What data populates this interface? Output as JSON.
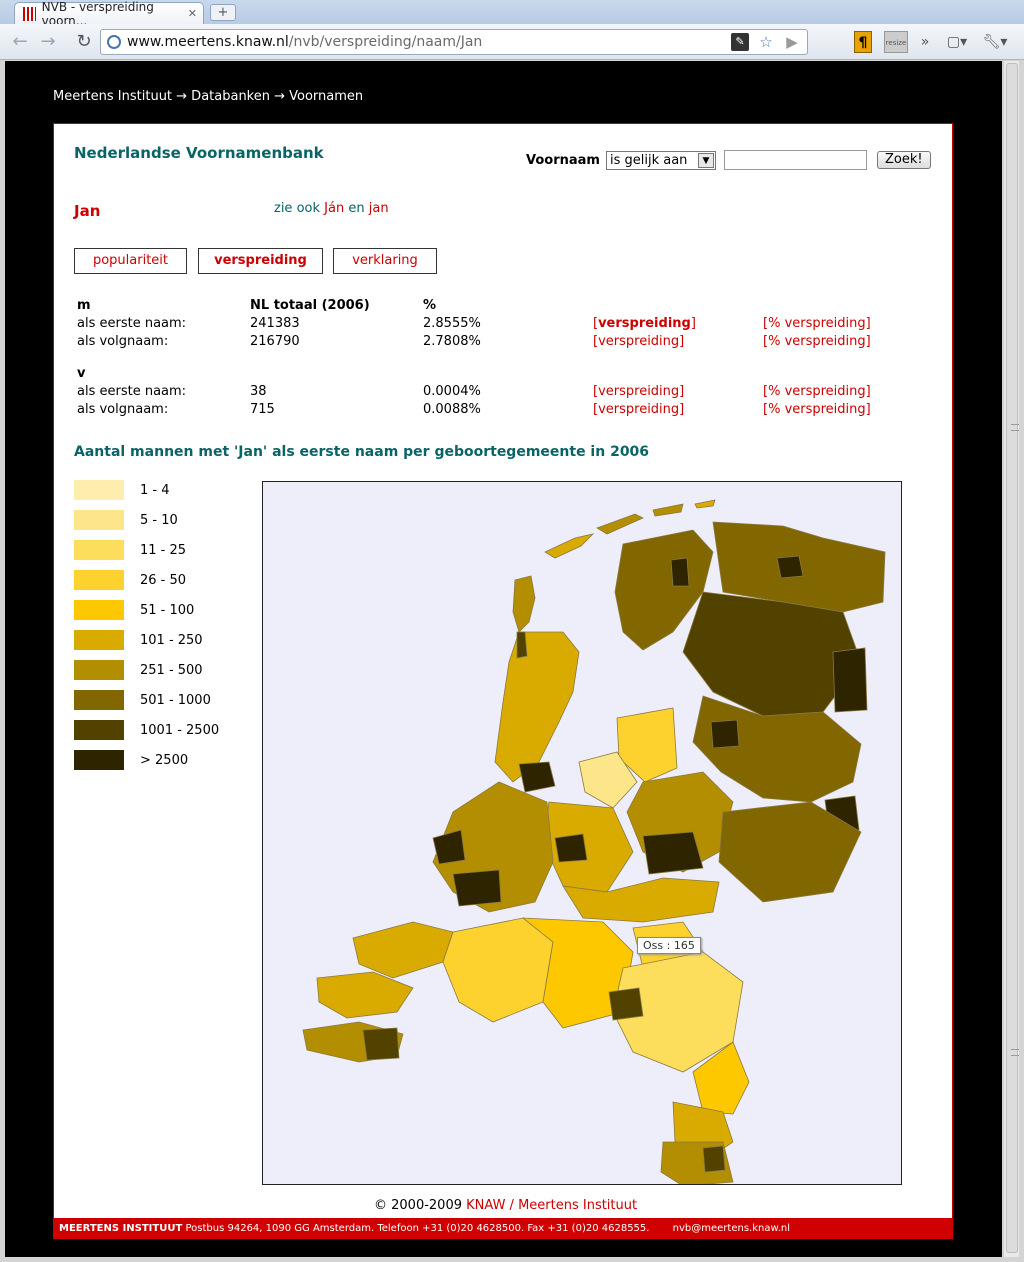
{
  "browser": {
    "tab_title": "NVB - verspreiding voorn...",
    "url_host": "www.meertens.knaw.nl",
    "url_path": "/nvb/verspreiding/naam/Jan",
    "resize_label": "resize"
  },
  "breadcrumb": {
    "text": "Meertens Instituut → Databanken → Voornamen"
  },
  "header": {
    "site_title": "Nederlandse Voornamenbank",
    "search_label": "Voornaam",
    "search_operator": "is gelijk aan",
    "search_value": "",
    "search_button": "Zoek!"
  },
  "name": {
    "title": "Jan",
    "see_also_prefix": "zie ook",
    "see_also_1": "Ján",
    "see_also_join": "en",
    "see_also_2": "jan"
  },
  "tabs": [
    {
      "label": "populariteit",
      "active": false
    },
    {
      "label": "verspreiding",
      "active": true
    },
    {
      "label": "verklaring",
      "active": false
    }
  ],
  "stats": {
    "col_total": "NL totaal (2006)",
    "col_pct": "%",
    "m_label": "m",
    "v_label": "v",
    "m_rows": [
      {
        "label": "als eerste naam:",
        "total": "241383",
        "pct": "2.8555%",
        "link1": "verspreiding",
        "link2": "% verspreiding"
      },
      {
        "label": "als volgnaam:",
        "total": "216790",
        "pct": "2.7808%",
        "link1": "verspreiding",
        "link2": "% verspreiding"
      }
    ],
    "v_rows": [
      {
        "label": "als eerste naam:",
        "total": "38",
        "pct": "0.0004%",
        "link1": "verspreiding",
        "link2": "% verspreiding"
      },
      {
        "label": "als volgnaam:",
        "total": "715",
        "pct": "0.0088%",
        "link1": "verspreiding",
        "link2": "% verspreiding"
      }
    ]
  },
  "map": {
    "title": "Aantal mannen met 'Jan' als eerste naam per geboortegemeente in 2006",
    "tooltip": "Oss : 165",
    "legend": [
      {
        "label": "1 - 4",
        "color": "#fdeeae"
      },
      {
        "label": "5 - 10",
        "color": "#fde68a"
      },
      {
        "label": "11 - 25",
        "color": "#fddd5c"
      },
      {
        "label": "26 - 50",
        "color": "#fdd12e"
      },
      {
        "label": "51 - 100",
        "color": "#fdc800"
      },
      {
        "label": "101 - 250",
        "color": "#d9aa00"
      },
      {
        "label": "251 - 500",
        "color": "#b28e00"
      },
      {
        "label": "501 - 1000",
        "color": "#826600"
      },
      {
        "label": "1001 - 2500",
        "color": "#524200"
      },
      {
        "label": "> 2500",
        "color": "#2e2400"
      }
    ]
  },
  "footer": {
    "copyright_prefix": "© 2000-2009",
    "copyright_link": "KNAW / Meertens Instituut",
    "org": "MEERTENS INSTITUUT",
    "address": "Postbus 94264, 1090 GG Amsterdam. Telefoon +31 (0)20 4628500. Fax +31 (0)20 4628555.",
    "email": "nvb@meertens.knaw.nl"
  }
}
